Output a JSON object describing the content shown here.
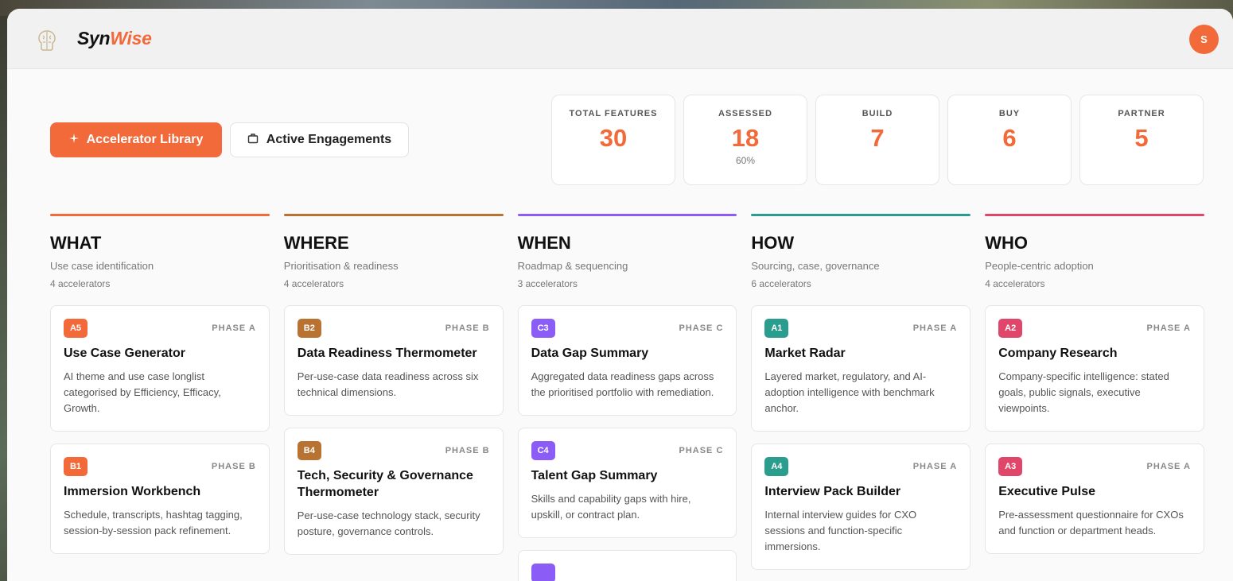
{
  "colors": {
    "accent": "#f26a3a",
    "what": "#f26a3a",
    "where": "#b87332",
    "when": "#8b5cf6",
    "how": "#2a9d8f",
    "who": "#e0456a"
  },
  "header": {
    "brand_main": "Syn",
    "brand_accent": "Wise",
    "avatar_initial": "S",
    "logo_icon": "brain-outline-icon"
  },
  "toolbar": {
    "library_label": "Accelerator Library",
    "library_icon": "plus-sparkle-icon",
    "engagements_label": "Active Engagements",
    "engagements_icon": "briefcase-icon"
  },
  "stats": [
    {
      "label": "TOTAL FEATURES",
      "value": "30",
      "sub": ""
    },
    {
      "label": "ASSESSED",
      "value": "18",
      "sub": "60%"
    },
    {
      "label": "BUILD",
      "value": "7",
      "sub": ""
    },
    {
      "label": "BUY",
      "value": "6",
      "sub": ""
    },
    {
      "label": "PARTNER",
      "value": "5",
      "sub": ""
    }
  ],
  "columns": [
    {
      "title": "WHAT",
      "subtitle": "Use case identification",
      "count": "4 accelerators",
      "color_key": "what",
      "cards": [
        {
          "tag": "A5",
          "phase": "PHASE A",
          "title": "Use Case Generator",
          "desc": "AI theme and use case longlist categorised by Efficiency, Efficacy, Growth."
        },
        {
          "tag": "B1",
          "phase": "PHASE B",
          "title": "Immersion Workbench",
          "desc": "Schedule, transcripts, hashtag tagging, session-by-session pack refinement."
        }
      ]
    },
    {
      "title": "WHERE",
      "subtitle": "Prioritisation & readiness",
      "count": "4 accelerators",
      "color_key": "where",
      "cards": [
        {
          "tag": "B2",
          "phase": "PHASE B",
          "title": "Data Readiness Thermometer",
          "desc": "Per-use-case data readiness across six technical dimensions."
        },
        {
          "tag": "B4",
          "phase": "PHASE B",
          "title": "Tech, Security & Governance Thermometer",
          "desc": "Per-use-case technology stack, security posture, governance controls."
        }
      ]
    },
    {
      "title": "WHEN",
      "subtitle": "Roadmap & sequencing",
      "count": "3 accelerators",
      "color_key": "when",
      "cards": [
        {
          "tag": "C3",
          "phase": "PHASE C",
          "title": "Data Gap Summary",
          "desc": "Aggregated data readiness gaps across the prioritised portfolio with remediation."
        },
        {
          "tag": "C4",
          "phase": "PHASE C",
          "title": "Talent Gap Summary",
          "desc": "Skills and capability gaps with hire, upskill, or contract plan."
        },
        {
          "tag": "",
          "phase": "",
          "title": "",
          "desc": ""
        }
      ]
    },
    {
      "title": "HOW",
      "subtitle": "Sourcing, case, governance",
      "count": "6 accelerators",
      "color_key": "how",
      "cards": [
        {
          "tag": "A1",
          "phase": "PHASE A",
          "title": "Market Radar",
          "desc": "Layered market, regulatory, and AI-adoption intelligence with benchmark anchor."
        },
        {
          "tag": "A4",
          "phase": "PHASE A",
          "title": "Interview Pack Builder",
          "desc": "Internal interview guides for CXO sessions and function-specific immersions."
        }
      ]
    },
    {
      "title": "WHO",
      "subtitle": "People-centric adoption",
      "count": "4 accelerators",
      "color_key": "who",
      "cards": [
        {
          "tag": "A2",
          "phase": "PHASE A",
          "title": "Company Research",
          "desc": "Company-specific intelligence: stated goals, public signals, executive viewpoints."
        },
        {
          "tag": "A3",
          "phase": "PHASE A",
          "title": "Executive Pulse",
          "desc": "Pre-assessment questionnaire for CXOs and function or department heads."
        }
      ]
    }
  ]
}
